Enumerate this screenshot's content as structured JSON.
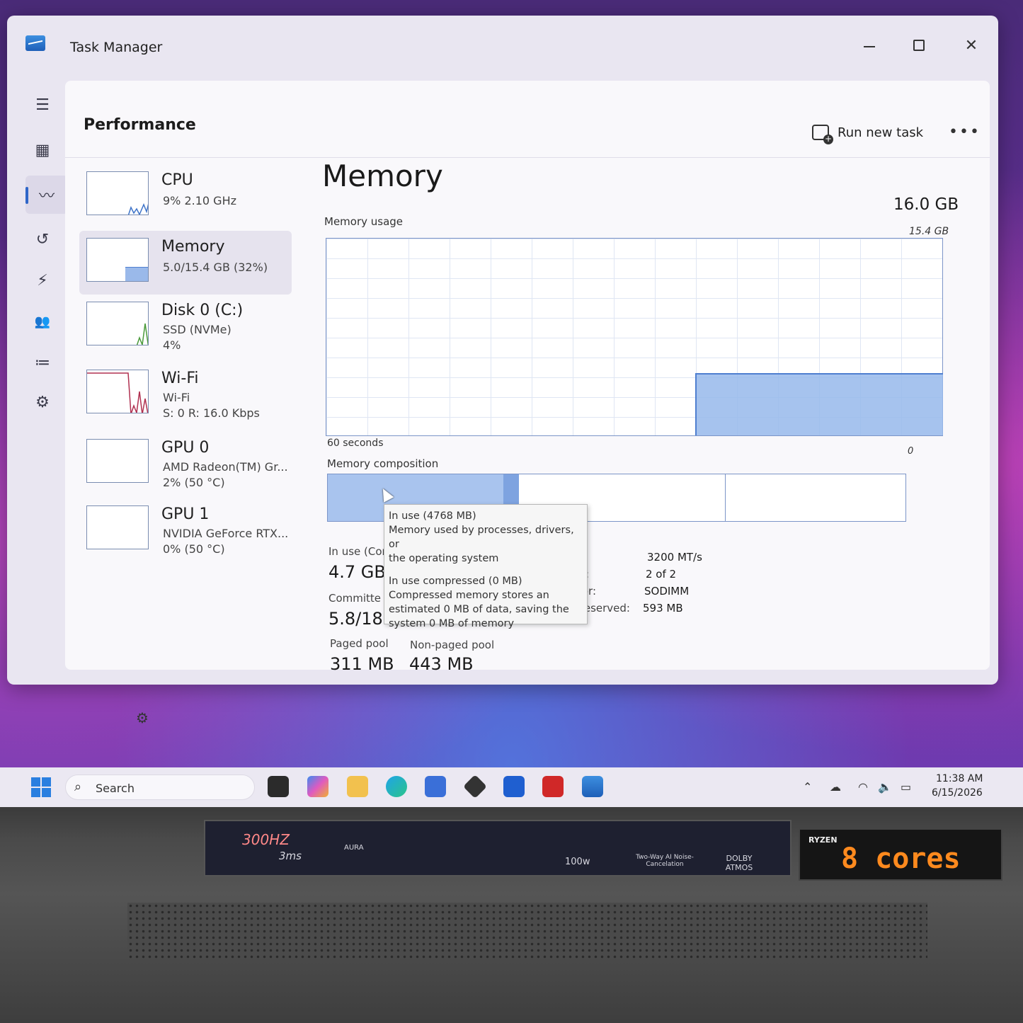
{
  "window": {
    "title": "Task Manager",
    "controls": {
      "minimize": "–",
      "maximize": "□",
      "close": "✕"
    }
  },
  "nav": [
    {
      "icon": "hamburger-menu-icon",
      "glyph": "☰"
    },
    {
      "icon": "processes-icon",
      "glyph": "▦"
    },
    {
      "icon": "performance-icon",
      "glyph": "〰",
      "active": true
    },
    {
      "icon": "app-history-icon",
      "glyph": "↺"
    },
    {
      "icon": "startup-apps-icon",
      "glyph": "⚡"
    },
    {
      "icon": "users-icon",
      "glyph": "👥"
    },
    {
      "icon": "details-icon",
      "glyph": "≔"
    },
    {
      "icon": "services-icon",
      "glyph": "⚙"
    }
  ],
  "header": {
    "title": "Performance",
    "run_new_task": "Run new task",
    "more": "•••"
  },
  "devices": [
    {
      "name": "CPU",
      "line1": "9%  2.10 GHz",
      "line2": ""
    },
    {
      "name": "Memory",
      "line1": "5.0/15.4 GB (32%)",
      "line2": "",
      "selected": true
    },
    {
      "name": "Disk 0 (C:)",
      "line1": "SSD (NVMe)",
      "line2": "4%"
    },
    {
      "name": "Wi-Fi",
      "line1": "Wi-Fi",
      "line2": "S: 0  R: 16.0 Kbps"
    },
    {
      "name": "GPU 0",
      "line1": "AMD Radeon(TM) Gr...",
      "line2": "2%  (50 °C)"
    },
    {
      "name": "GPU 1",
      "line1": "NVIDIA GeForce RTX...",
      "line2": "0%  (50 °C)"
    }
  ],
  "memory": {
    "title": "Memory",
    "total": "16.0 GB",
    "usage_label": "Memory usage",
    "usage_max": "15.4 GB",
    "axis_left": "60 seconds",
    "axis_right": "0",
    "composition_label": "Memory composition",
    "in_use_fraction": 0.32,
    "stats": {
      "in_use_label": "In use (Cor",
      "in_use_value": "4.7 GB",
      "committed_label": "Committe",
      "committed_value": "5.8/18.",
      "paged_pool_label": "Paged pool",
      "paged_pool_value": "311 MB",
      "nonpaged_pool_label": "Non-paged pool",
      "nonpaged_pool_value": "443 MB"
    },
    "specs": [
      {
        "label": "",
        "value": "3200 MT/s"
      },
      {
        "label": "d:",
        "value": "2 of 2"
      },
      {
        "label": "or:",
        "value": "SODIMM"
      },
      {
        "label": "e reserved:",
        "value": "593 MB"
      }
    ]
  },
  "tooltip": {
    "line1": "In use (4768 MB)",
    "line2": "Memory used by processes, drivers, or",
    "line3": "the operating system",
    "line4": "In use compressed (0 MB)",
    "line5": "Compressed memory stores an",
    "line6": "estimated 0 MB of data, saving the",
    "line7": "system 0 MB of memory"
  },
  "taskbar": {
    "search_placeholder": "Search",
    "time": "11:38 AM",
    "date": "6/15/2026"
  },
  "laptop": {
    "sticker_300hz": "300HZ",
    "sticker_3ms": "3ms",
    "sticker_aura": "AURA",
    "sticker_100w": "100w",
    "sticker_noise": "Two-Way AI Noise-Cancelation",
    "sticker_dolby": "DOLBY ATMOS",
    "ryzen_brand": "RYZEN",
    "ryzen_cores": "8 cores"
  },
  "colors": {
    "accent": "#2f66c8",
    "graph_fill": "#96b9eb",
    "graph_line": "#4f7fd0"
  }
}
